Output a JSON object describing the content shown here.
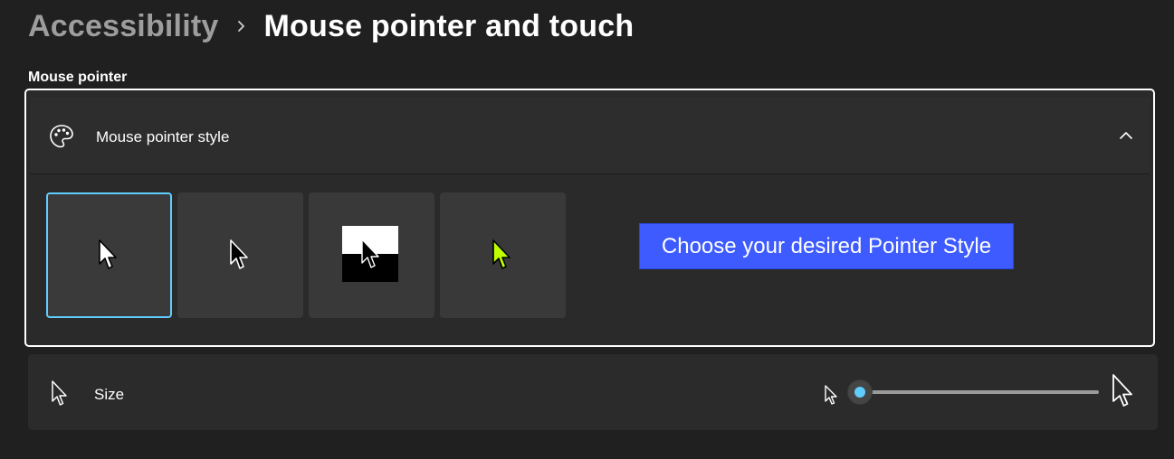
{
  "breadcrumb": {
    "parent": "Accessibility",
    "current": "Mouse pointer and touch"
  },
  "section": {
    "label": "Mouse pointer"
  },
  "pointer_style": {
    "title": "Mouse pointer style",
    "expanded": true,
    "options": [
      {
        "name": "White",
        "selected": true
      },
      {
        "name": "Black",
        "selected": false
      },
      {
        "name": "Inverted",
        "selected": false
      },
      {
        "name": "Custom",
        "selected": false,
        "color": "#bfff00"
      }
    ],
    "callout": "Choose your desired Pointer Style"
  },
  "size": {
    "label": "Size",
    "value": 1,
    "min": 1,
    "max": 15
  },
  "colors": {
    "accent": "#60cdff",
    "background": "#202020",
    "callout": "#3d5bff",
    "custom_pointer": "#bfff00"
  }
}
